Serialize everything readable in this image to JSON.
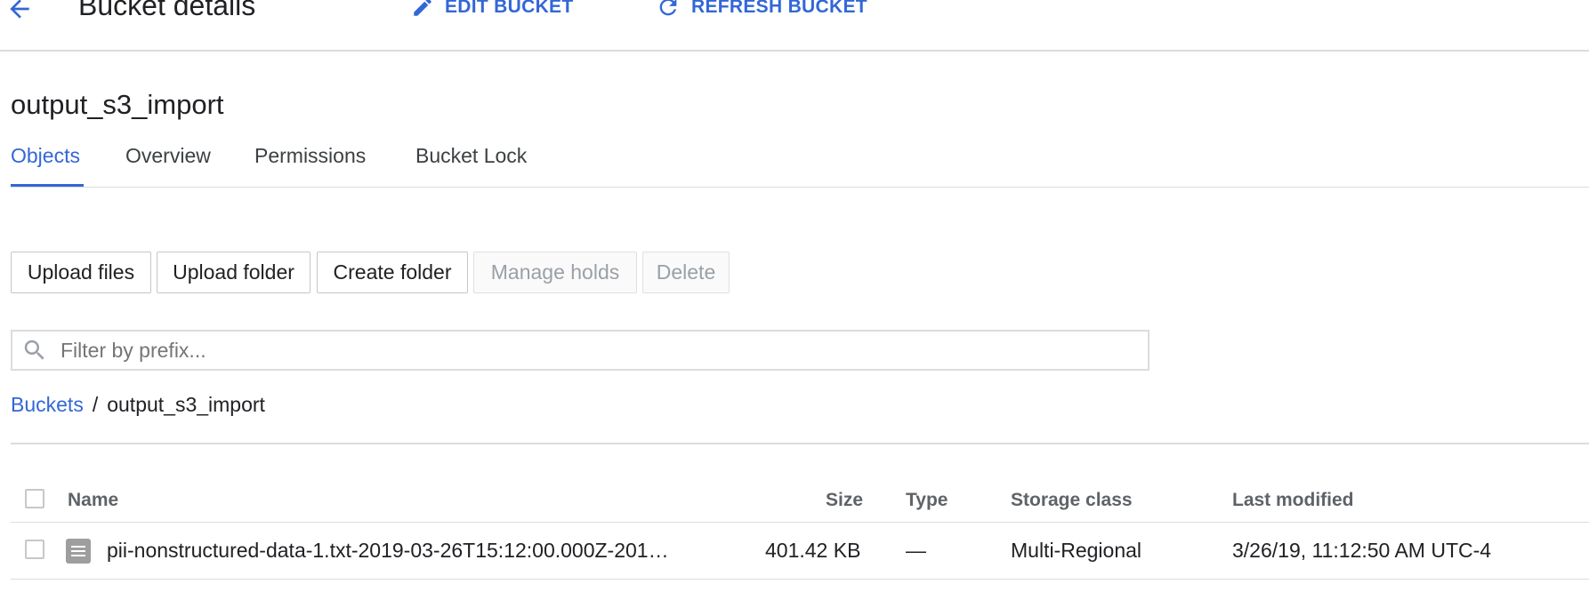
{
  "header": {
    "title": "Bucket details",
    "edit_label": "EDIT BUCKET",
    "refresh_label": "REFRESH BUCKET"
  },
  "bucket": {
    "name": "output_s3_import"
  },
  "tabs": [
    {
      "label": "Objects",
      "active": true
    },
    {
      "label": "Overview"
    },
    {
      "label": "Permissions"
    },
    {
      "label": "Bucket Lock"
    }
  ],
  "actions": {
    "upload_files": "Upload files",
    "upload_folder": "Upload folder",
    "create_folder": "Create folder",
    "manage_holds": "Manage holds",
    "delete": "Delete"
  },
  "filter": {
    "placeholder": "Filter by prefix..."
  },
  "breadcrumb": {
    "root": "Buckets",
    "separator": "/",
    "current": "output_s3_import"
  },
  "table": {
    "columns": {
      "name": "Name",
      "size": "Size",
      "type": "Type",
      "storage_class": "Storage class",
      "last_modified": "Last modified"
    },
    "rows": [
      {
        "name": "pii-nonstructured-data-1.txt-2019-03-26T15:12:00.000Z-201…",
        "size": "401.42 KB",
        "type": "—",
        "storage_class": "Multi-Regional",
        "last_modified": "3/26/19, 11:12:50 AM UTC-4"
      }
    ]
  },
  "colors": {
    "accent": "#3367d6",
    "divider": "#dadce0"
  }
}
